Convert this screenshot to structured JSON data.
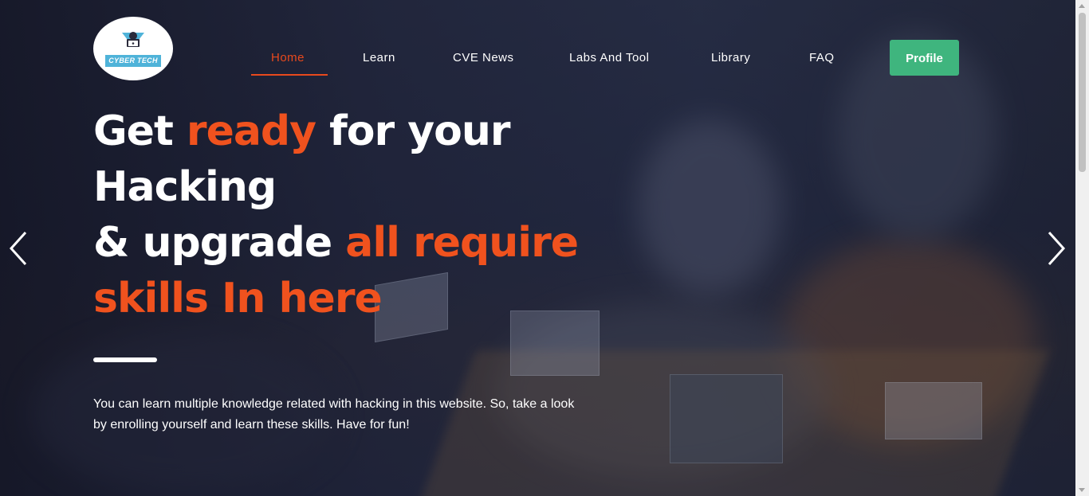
{
  "logo": {
    "text": "CYBER TECH",
    "icon": "hacker-laptop-logo"
  },
  "nav": {
    "items": [
      {
        "label": "Home",
        "active": true
      },
      {
        "label": "Learn",
        "active": false
      },
      {
        "label": "CVE News",
        "active": false
      },
      {
        "label": "Labs And Tool",
        "active": false
      },
      {
        "label": "Library",
        "active": false
      },
      {
        "label": "FAQ",
        "active": false
      }
    ],
    "profile_label": "Profile"
  },
  "hero": {
    "title_part1": "Get ",
    "title_accent1": "ready",
    "title_part2": " for your Hacking",
    "title_part3": "& upgrade ",
    "title_accent2": "all require skills In here",
    "description": "You can learn multiple knowledge related with hacking in this website. So, take a look by enrolling yourself and learn these skills. Have for fun!"
  },
  "carousel": {
    "prev_icon": "chevron-left-icon",
    "next_icon": "chevron-right-icon"
  },
  "colors": {
    "accent": "#f0521e",
    "nav_active": "#e8491d",
    "profile_button": "#3fb57e",
    "logo_band": "#4fb3d9"
  }
}
